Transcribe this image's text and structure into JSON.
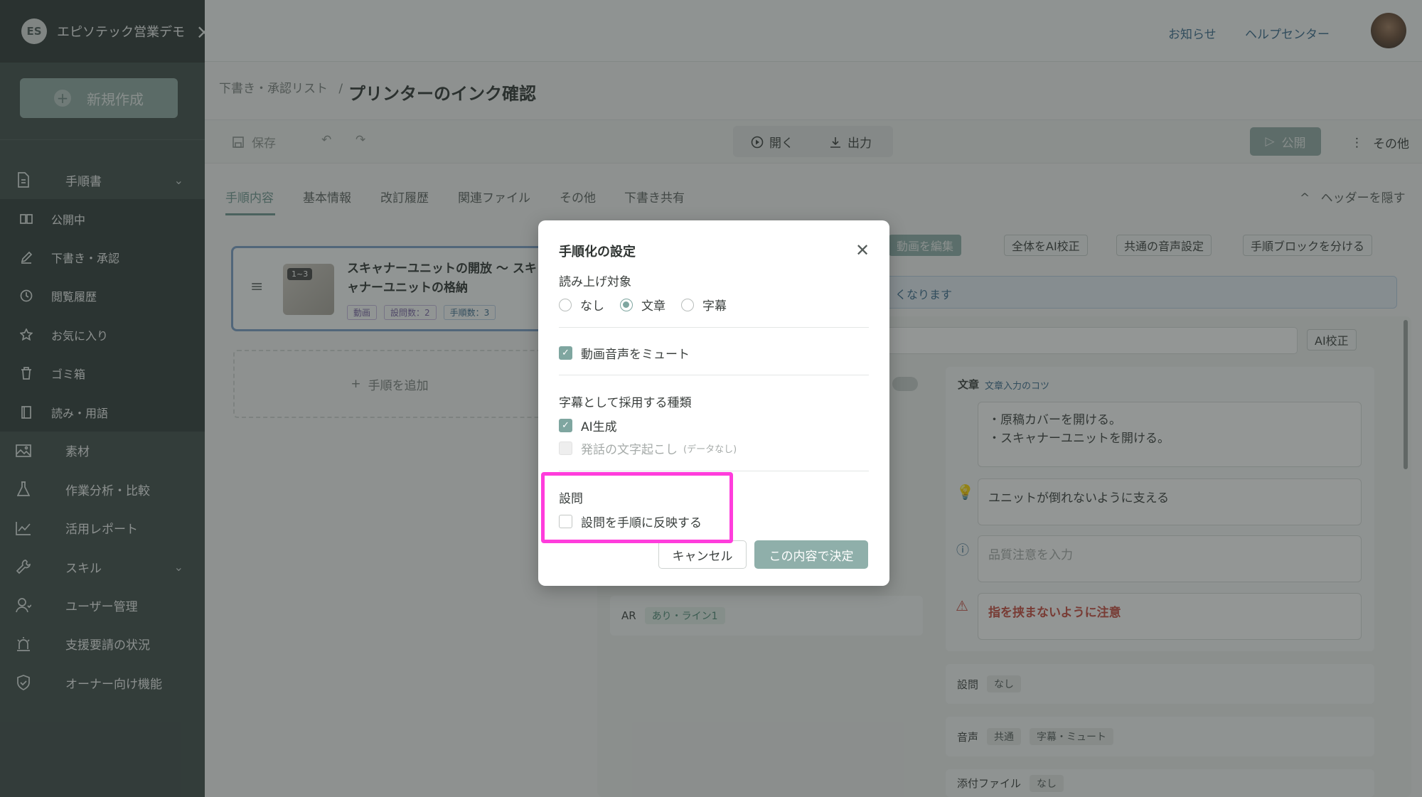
{
  "sidebar": {
    "brand": "エピソテック営業デモ",
    "new_button": "新規作成",
    "items": [
      {
        "label": "手順書",
        "icon": "document-icon"
      },
      {
        "label": "公開中",
        "icon": "book-icon"
      },
      {
        "label": "下書き・承認",
        "icon": "pencil-icon"
      },
      {
        "label": "閲覧履歴",
        "icon": "clock-icon"
      },
      {
        "label": "お気に入り",
        "icon": "star-icon"
      },
      {
        "label": "ゴミ箱",
        "icon": "trash-icon"
      },
      {
        "label": "読み・用語",
        "icon": "notebook-icon"
      },
      {
        "label": "素材",
        "icon": "image-icon"
      },
      {
        "label": "作業分析・比較",
        "icon": "flask-icon"
      },
      {
        "label": "活用レポート",
        "icon": "chart-icon"
      },
      {
        "label": "スキル",
        "icon": "wrench-icon"
      },
      {
        "label": "ユーザー管理",
        "icon": "users-icon"
      },
      {
        "label": "支援要請の状況",
        "icon": "alarm-icon"
      },
      {
        "label": "オーナー向け機能",
        "icon": "shield-icon"
      }
    ]
  },
  "topbar": {
    "news": "お知らせ",
    "help": "ヘルプセンター"
  },
  "breadcrumb": {
    "parent": "下書き・承認リスト",
    "sep": "/",
    "title": "プリンターのインク確認"
  },
  "toolbar": {
    "save": "保存",
    "open": "開く",
    "export": "出力",
    "publish": "公開",
    "other": "その他"
  },
  "tabs": {
    "items": [
      "手順内容",
      "基本情報",
      "改訂履歴",
      "関連ファイル",
      "その他",
      "下書き共有"
    ],
    "hide_header": "ヘッダーを隠す"
  },
  "step_card": {
    "range": "1~3",
    "title": "スキャナーユニットの開放 ～ スキャナーユニットの格納",
    "tag_video": "動画",
    "tag_questions": "設問数：2",
    "tag_steps": "手順数：3"
  },
  "add_step": "手順を追加",
  "right_tools": {
    "edit_video": "動画を編集",
    "ai_all": "全体をAI校正",
    "voice": "共通の音声設定",
    "split": "手順ブロックを分ける",
    "ai_fix": "AI校正",
    "info": "くなります"
  },
  "text_panel": {
    "label": "文章",
    "tips": "文章入力のコツ",
    "body1": "・原稿カバーを開ける。",
    "body2": "・スキャナーユニットを開ける。",
    "hint": "ユニットが倒れないように支える",
    "quality_placeholder": "品質注意を入力",
    "warning": "指を挟まないように注意"
  },
  "rows": {
    "ar_label": "AR",
    "ar_value": "あり・ライン1",
    "q_label": "設問",
    "q_value": "なし",
    "audio_label": "音声",
    "audio_v1": "共通",
    "audio_v2": "字幕・ミュート",
    "attach_label": "添付ファイル",
    "attach_value": "なし"
  },
  "dialog": {
    "title": "手順化の設定",
    "read_target": "読み上げ対象",
    "opt_none": "なし",
    "opt_text": "文章",
    "opt_sub": "字幕",
    "mute": "動画音声をミュート",
    "subtitle_kind": "字幕として採用する種類",
    "ai_gen": "AI生成",
    "speech_transcribe": "発話の文字起こし",
    "no_data": "(データなし)",
    "question_section": "設問",
    "question_reflect": "設問を手順に反映する",
    "cancel": "キャンセル",
    "confirm": "この内容で決定"
  },
  "colors": {
    "accent": "#7fa6a0",
    "highlight": "#ff3ddc",
    "sidebar": "#3e4c49",
    "link": "#3b6c8f"
  }
}
